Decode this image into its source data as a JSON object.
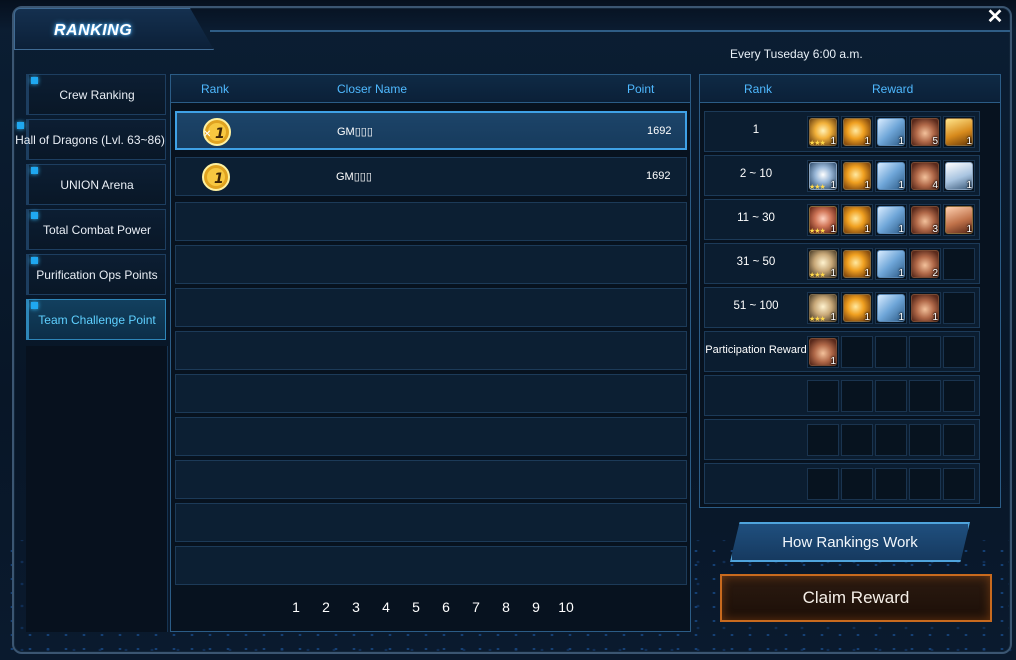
{
  "window": {
    "title": "RANKING",
    "close_label": "✕",
    "schedule": "Every Tuseday 6:00 a.m."
  },
  "sidebar": {
    "items": [
      {
        "label": "Crew Ranking",
        "active": false
      },
      {
        "label": "Hall of Dragons (Lvl. 63~86)",
        "active": false
      },
      {
        "label": "UNION Arena",
        "active": false
      },
      {
        "label": "Total Combat Power",
        "active": false
      },
      {
        "label": "Purification Ops Points",
        "active": false
      },
      {
        "label": "Team Challenge Point",
        "active": true
      }
    ]
  },
  "ranking_list": {
    "headers": {
      "rank": "Rank",
      "name": "Closer Name",
      "point": "Point"
    },
    "rows": [
      {
        "rank": 1,
        "name": "GM▯▯▯",
        "point": "1692",
        "selected": true
      },
      {
        "rank": 1,
        "name": "GM▯▯▯",
        "point": "1692",
        "selected": false
      }
    ],
    "empty_rows": 8,
    "pages": [
      "1",
      "2",
      "3",
      "4",
      "5",
      "6",
      "7",
      "8",
      "9",
      "10"
    ]
  },
  "rewards": {
    "headers": {
      "rank": "Rank",
      "reward": "Reward"
    },
    "rows": [
      {
        "rank": "1",
        "items": [
          {
            "icon": "badge-gold",
            "qty": "1",
            "stars": "★★★"
          },
          {
            "icon": "gold",
            "qty": "1"
          },
          {
            "icon": "ticket",
            "qty": "1"
          },
          {
            "icon": "pouch",
            "qty": "5"
          },
          {
            "icon": "chest-gold",
            "qty": "1"
          }
        ]
      },
      {
        "rank": "2 ~ 10",
        "items": [
          {
            "icon": "badge-silver",
            "qty": "1",
            "stars": "★★★"
          },
          {
            "icon": "gold",
            "qty": "1"
          },
          {
            "icon": "ticket",
            "qty": "1"
          },
          {
            "icon": "pouch",
            "qty": "4"
          },
          {
            "icon": "chest-silver",
            "qty": "1"
          }
        ]
      },
      {
        "rank": "11 ~ 30",
        "items": [
          {
            "icon": "badge-bronze",
            "qty": "1",
            "stars": "★★★"
          },
          {
            "icon": "gold",
            "qty": "1"
          },
          {
            "icon": "ticket",
            "qty": "1"
          },
          {
            "icon": "pouch",
            "qty": "3"
          },
          {
            "icon": "chest-bronze",
            "qty": "1"
          }
        ]
      },
      {
        "rank": "31 ~ 50",
        "items": [
          {
            "icon": "badge-plain",
            "qty": "1",
            "stars": "★★★"
          },
          {
            "icon": "gold",
            "qty": "1"
          },
          {
            "icon": "ticket",
            "qty": "1"
          },
          {
            "icon": "pouch",
            "qty": "2"
          }
        ]
      },
      {
        "rank": "51 ~ 100",
        "items": [
          {
            "icon": "badge-plain",
            "qty": "1",
            "stars": "★★★"
          },
          {
            "icon": "gold",
            "qty": "1"
          },
          {
            "icon": "ticket",
            "qty": "1"
          },
          {
            "icon": "pouch",
            "qty": "1"
          }
        ]
      },
      {
        "rank": "Participation Reward",
        "items": [
          {
            "icon": "pouch",
            "qty": "1"
          }
        ]
      },
      {
        "rank": "",
        "items": []
      },
      {
        "rank": "",
        "items": []
      },
      {
        "rank": "",
        "items": []
      }
    ]
  },
  "buttons": {
    "how": "How Rankings Work",
    "claim": "Claim Reward"
  },
  "colors": {
    "accent": "#4fb9ff",
    "active_text": "#5fd0ff",
    "claim_border": "#c86a1e",
    "bg": "#081627"
  }
}
